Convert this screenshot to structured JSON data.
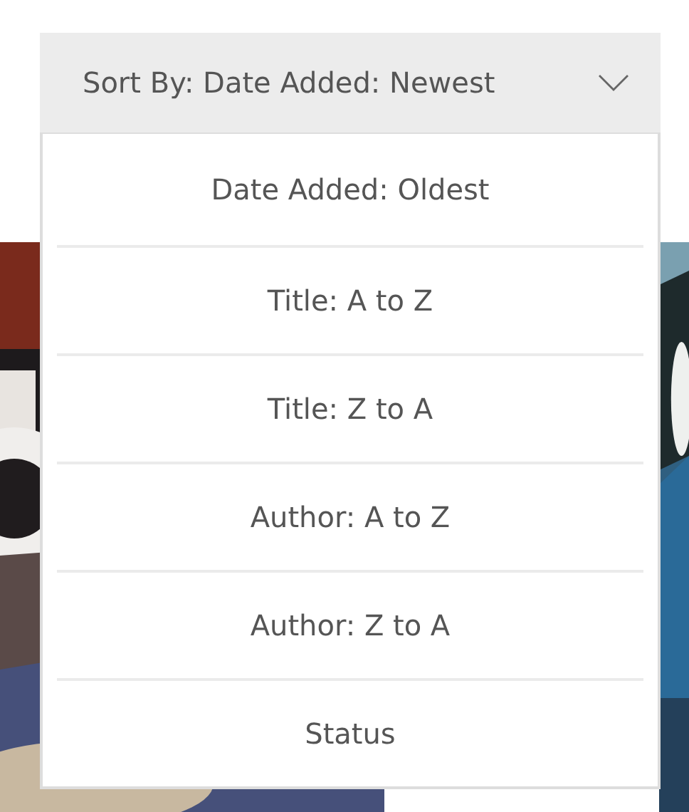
{
  "sort_button": {
    "label": "Sort By: Date Added: Newest",
    "expanded": true
  },
  "options": [
    {
      "label": "Date Added: Oldest",
      "selected": false
    },
    {
      "label": "Title: A to Z",
      "selected": false
    },
    {
      "label": "Title: Z to A",
      "selected": false
    },
    {
      "label": "Author: A to Z",
      "selected": false
    },
    {
      "label": "Author: Z to A",
      "selected": false
    },
    {
      "label": "Status",
      "selected": false
    }
  ]
}
